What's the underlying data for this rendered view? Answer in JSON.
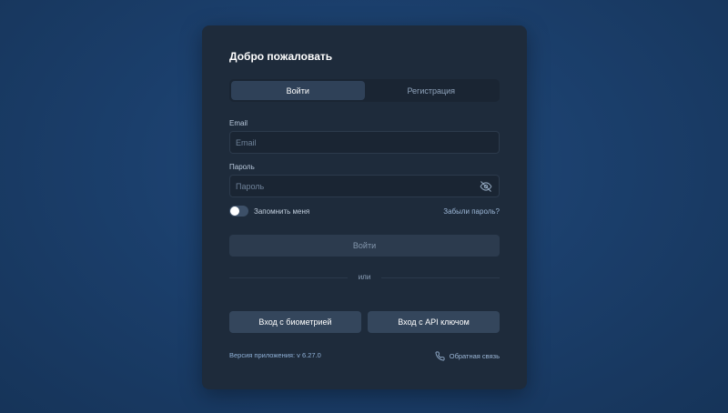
{
  "card": {
    "title": "Добро пожаловать"
  },
  "tabs": [
    {
      "label": "Войти",
      "active": true
    },
    {
      "label": "Регистрация",
      "active": false
    }
  ],
  "form": {
    "email_label": "Email",
    "email_placeholder": "Email",
    "password_label": "Пароль",
    "password_placeholder": "Пароль",
    "remember_label": "Запомнить меня",
    "remember_checked": false,
    "forgot_link": "Забыли пароль?",
    "submit_label": "Войти"
  },
  "divider_text": "или",
  "alt_buttons": {
    "biometric": "Вход с биометрией",
    "api_key": "Вход с API ключом"
  },
  "footer": {
    "version": "Версия приложения: v 6.27.0",
    "feedback": "Обратная связь"
  },
  "icons": {
    "password_toggle": "eye-off-icon",
    "feedback": "phone-icon"
  },
  "colors": {
    "background": "#1b3f6c",
    "card": "#1e2b3b",
    "accent_link": "#9db8d8"
  }
}
